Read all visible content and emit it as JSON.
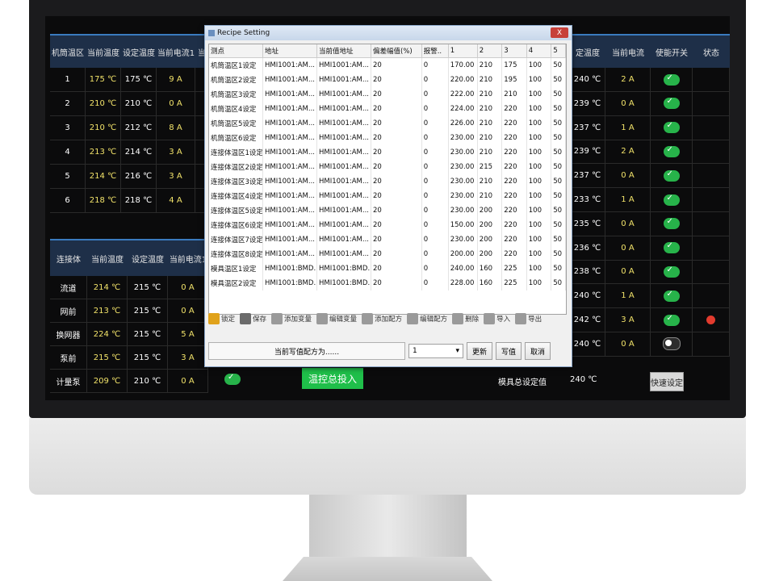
{
  "left_panel": {
    "headers": [
      "机筒温区",
      "当前温度",
      "设定温度",
      "当前电流1",
      "当"
    ],
    "rows": [
      {
        "zone": "1",
        "current": "175 ℃",
        "set": "175 ℃",
        "amp": "9 A"
      },
      {
        "zone": "2",
        "current": "210 ℃",
        "set": "210 ℃",
        "amp": "0 A"
      },
      {
        "zone": "3",
        "current": "210 ℃",
        "set": "212 ℃",
        "amp": "8 A"
      },
      {
        "zone": "4",
        "current": "213 ℃",
        "set": "214 ℃",
        "amp": "3 A"
      },
      {
        "zone": "5",
        "current": "214 ℃",
        "set": "216 ℃",
        "amp": "3 A"
      },
      {
        "zone": "6",
        "current": "218 ℃",
        "set": "218 ℃",
        "amp": "4 A"
      }
    ],
    "headers2": [
      "连接体",
      "当前温度",
      "设定温度",
      "当前电流1"
    ],
    "rows2": [
      {
        "zone": "流道",
        "current": "214 ℃",
        "set": "215 ℃",
        "amp": "0 A"
      },
      {
        "zone": "网前",
        "current": "213 ℃",
        "set": "215 ℃",
        "amp": "0 A"
      },
      {
        "zone": "换网器",
        "current": "224 ℃",
        "set": "215 ℃",
        "amp": "5 A"
      },
      {
        "zone": "泵前",
        "current": "215 ℃",
        "set": "215 ℃",
        "amp": "3 A"
      },
      {
        "zone": "计量泵",
        "current": "209 ℃",
        "set": "210 ℃",
        "amp": "0 A"
      }
    ]
  },
  "right_panel": {
    "headers": [
      "定温度",
      "当前电流",
      "使能开关",
      "状态"
    ],
    "rows": [
      {
        "set": "240 ℃",
        "amp": "2 A",
        "on": true
      },
      {
        "set": "239 ℃",
        "amp": "0 A",
        "on": true
      },
      {
        "set": "237 ℃",
        "amp": "1 A",
        "on": true
      },
      {
        "set": "239 ℃",
        "amp": "2 A",
        "on": true
      },
      {
        "set": "237 ℃",
        "amp": "0 A",
        "on": true
      },
      {
        "set": "233 ℃",
        "amp": "1 A",
        "on": true
      },
      {
        "set": "235 ℃",
        "amp": "0 A",
        "on": true
      },
      {
        "set": "236 ℃",
        "amp": "0 A",
        "on": true
      },
      {
        "set": "238 ℃",
        "amp": "0 A",
        "on": true
      },
      {
        "set": "240 ℃",
        "amp": "1 A",
        "on": true
      },
      {
        "set": "242 ℃",
        "amp": "3 A",
        "on": true
      },
      {
        "set": "240 ℃",
        "amp": "0 A",
        "on": false
      }
    ],
    "mold_total_label": "模具总设定值",
    "mold_total_value": "240 ℃",
    "quick_set": "快速设定"
  },
  "temp_control_button": "温控总投入",
  "dialog": {
    "title": "Recipe Setting",
    "close": "X",
    "columns": [
      "测点",
      "地址",
      "当前值地址",
      "偏差幅值(%)",
      "报警..",
      "1",
      "2",
      "3",
      "4",
      "5"
    ],
    "rows": [
      [
        "机筒温区1设定",
        "HMI1001:AM...",
        "HMI1001:AM...",
        "20",
        "0",
        "170.00",
        "210",
        "175",
        "100",
        "50"
      ],
      [
        "机筒温区2设定",
        "HMI1001:AM...",
        "HMI1001:AM...",
        "20",
        "0",
        "220.00",
        "210",
        "195",
        "100",
        "50"
      ],
      [
        "机筒温区3设定",
        "HMI1001:AM...",
        "HMI1001:AM...",
        "20",
        "0",
        "222.00",
        "210",
        "210",
        "100",
        "50"
      ],
      [
        "机筒温区4设定",
        "HMI1001:AM...",
        "HMI1001:AM...",
        "20",
        "0",
        "224.00",
        "210",
        "220",
        "100",
        "50"
      ],
      [
        "机筒温区5设定",
        "HMI1001:AM...",
        "HMI1001:AM...",
        "20",
        "0",
        "226.00",
        "210",
        "220",
        "100",
        "50"
      ],
      [
        "机筒温区6设定",
        "HMI1001:AM...",
        "HMI1001:AM...",
        "20",
        "0",
        "230.00",
        "210",
        "220",
        "100",
        "50"
      ],
      [
        "连接体温区1设定",
        "HMI1001:AM...",
        "HMI1001:AM...",
        "20",
        "0",
        "230.00",
        "210",
        "220",
        "100",
        "50"
      ],
      [
        "连接体温区2设定",
        "HMI1001:AM...",
        "HMI1001:AM...",
        "20",
        "0",
        "230.00",
        "215",
        "220",
        "100",
        "50"
      ],
      [
        "连接体温区3设定",
        "HMI1001:AM...",
        "HMI1001:AM...",
        "20",
        "0",
        "230.00",
        "210",
        "220",
        "100",
        "50"
      ],
      [
        "连接体温区4设定",
        "HMI1001:AM...",
        "HMI1001:AM...",
        "20",
        "0",
        "230.00",
        "210",
        "220",
        "100",
        "50"
      ],
      [
        "连接体温区5设定",
        "HMI1001:AM...",
        "HMI1001:AM...",
        "20",
        "0",
        "230.00",
        "200",
        "220",
        "100",
        "50"
      ],
      [
        "连接体温区6设定",
        "HMI1001:AM...",
        "HMI1001:AM...",
        "20",
        "0",
        "150.00",
        "200",
        "220",
        "100",
        "50"
      ],
      [
        "连接体温区7设定",
        "HMI1001:AM...",
        "HMI1001:AM...",
        "20",
        "0",
        "230.00",
        "200",
        "220",
        "100",
        "50"
      ],
      [
        "连接体温区8设定",
        "HMI1001:AM...",
        "HMI1001:AM...",
        "20",
        "0",
        "200.00",
        "200",
        "220",
        "100",
        "50"
      ],
      [
        "模具温区1设定",
        "HMI1001:BMD...",
        "HMI1001:BMD...",
        "20",
        "0",
        "240.00",
        "160",
        "225",
        "100",
        "50"
      ],
      [
        "模具温区2设定",
        "HMI1001:BMD...",
        "HMI1001:BMD...",
        "20",
        "0",
        "228.00",
        "160",
        "225",
        "100",
        "50"
      ]
    ],
    "toolbar": [
      "锁定",
      "保存",
      "添加变量",
      "编辑变量",
      "添加配方",
      "编辑配方",
      "删除",
      "导入",
      "导出"
    ],
    "delete_badge": "删除",
    "status_text": "当前写值配方为......",
    "combo_value": "1",
    "combo_arrow": "▾",
    "btn_update": "更新",
    "btn_write": "写值",
    "btn_cancel": "取消"
  }
}
